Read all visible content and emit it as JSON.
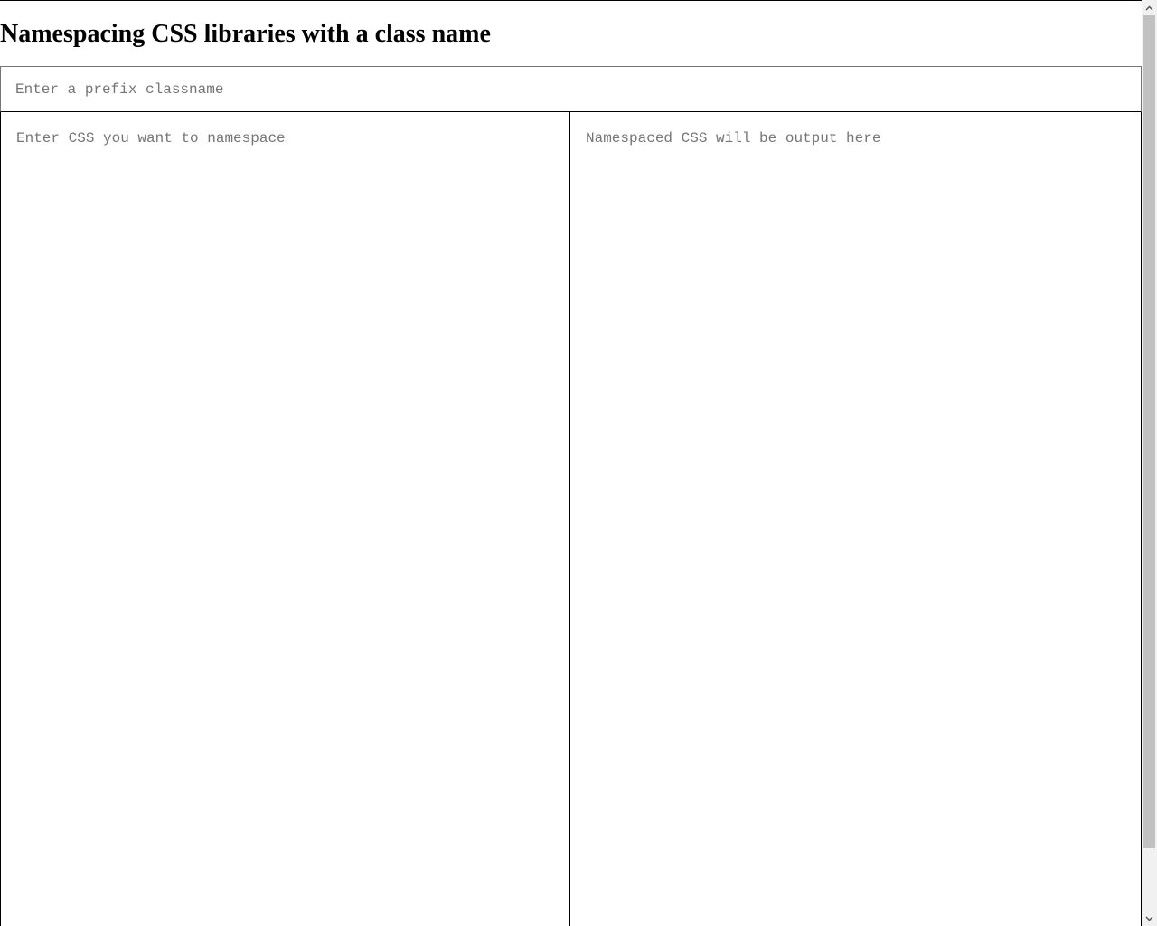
{
  "page": {
    "title": "Namespacing CSS libraries with a class name"
  },
  "prefix_input": {
    "value": "",
    "placeholder": "Enter a prefix classname"
  },
  "css_input": {
    "value": "",
    "placeholder": "Enter CSS you want to namespace"
  },
  "css_output": {
    "value": "",
    "placeholder": "Namespaced CSS will be output here"
  },
  "icons": {
    "scroll_up": "chevron-up-icon",
    "scroll_down": "chevron-down-icon"
  },
  "colors": {
    "text": "#000000",
    "placeholder": "#757575",
    "input_border": "#767676",
    "scrollbar_track": "#f1f1f1",
    "scrollbar_thumb": "#c1c1c1"
  }
}
